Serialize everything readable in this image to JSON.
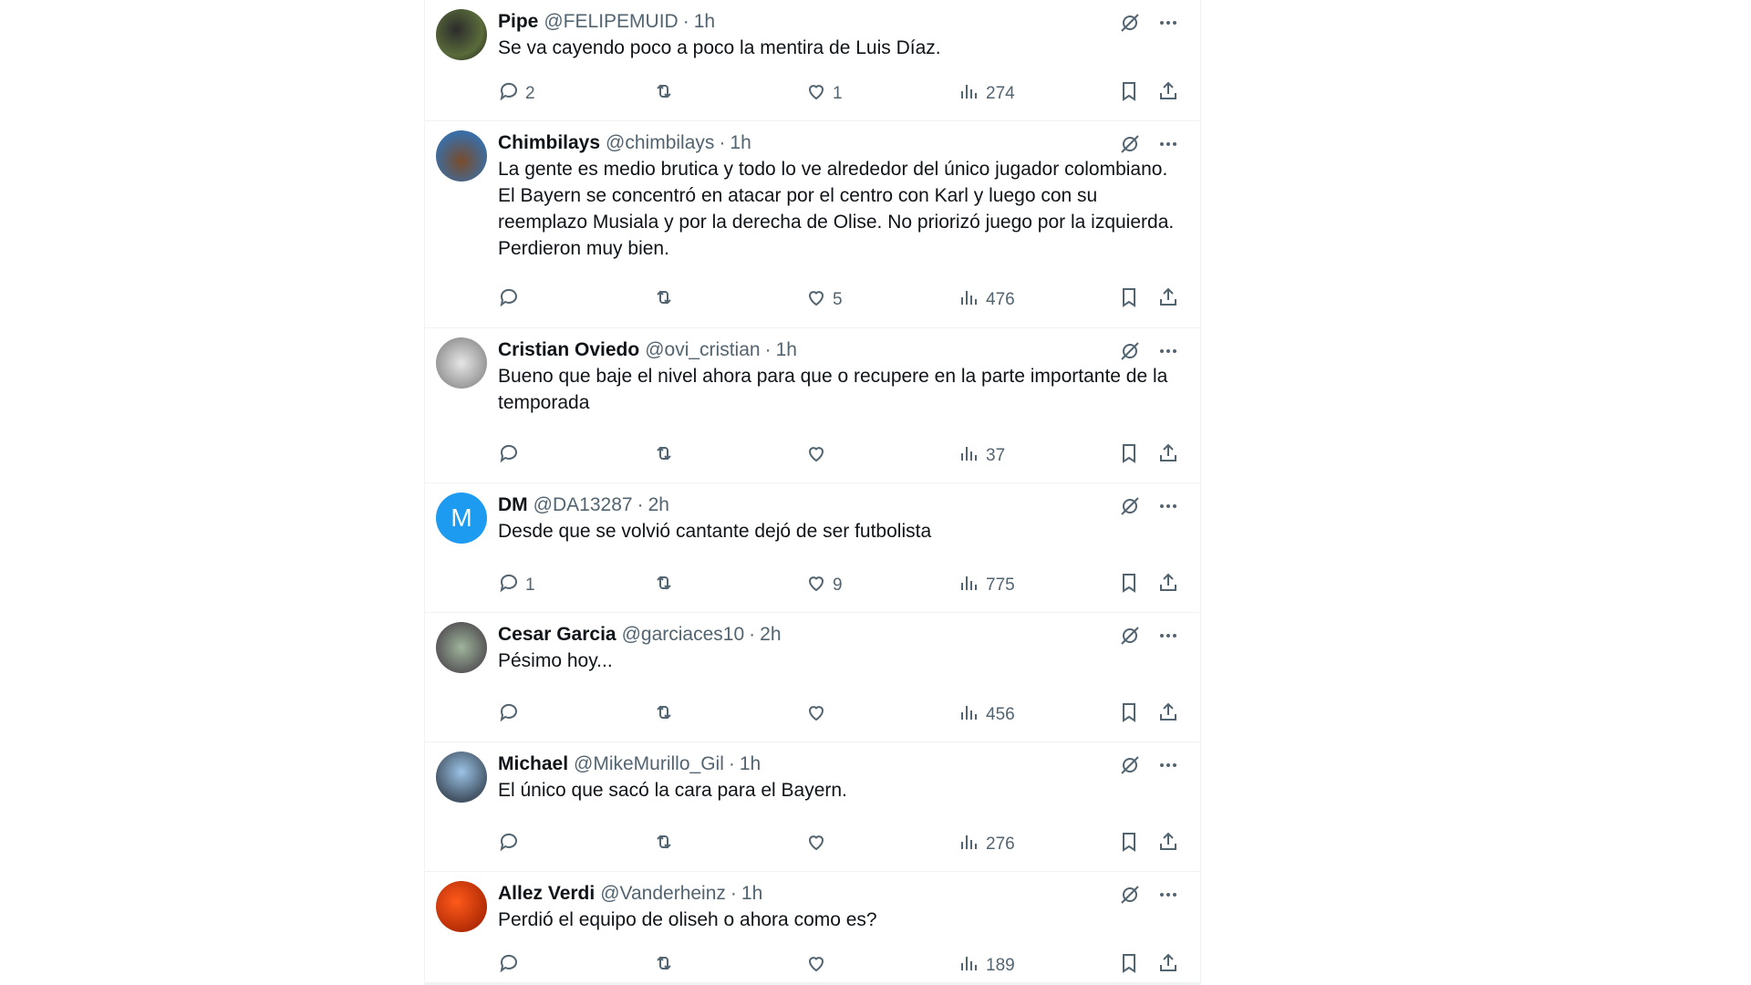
{
  "tweets": [
    {
      "name": "Pipe",
      "handle": "@FELIPEMUID",
      "time": "1h",
      "text": "Se va cayendo poco a poco la mentira de Luis Díaz.",
      "replies": "2",
      "reposts": "",
      "likes": "1",
      "views": "274",
      "avatar_letter": ""
    },
    {
      "name": "Chimbilays",
      "handle": "@chimbilays",
      "time": "1h",
      "text": "La gente es medio brutica y todo lo ve alrededor del único jugador colombiano. El Bayern se concentró en atacar por el centro con Karl y luego con su reemplazo Musiala y por la derecha de Olise. No priorizó juego por la izquierda. Perdieron muy bien.",
      "replies": "",
      "reposts": "",
      "likes": "5",
      "views": "476",
      "avatar_letter": ""
    },
    {
      "name": "Cristian Oviedo",
      "handle": "@ovi_cristian",
      "time": "1h",
      "text": "Bueno que baje el nivel ahora para que o recupere en la parte importante de la temporada",
      "replies": "",
      "reposts": "",
      "likes": "",
      "views": "37",
      "avatar_letter": ""
    },
    {
      "name": "DM",
      "handle": "@DA13287",
      "time": "2h",
      "text": "Desde que se volvió cantante dejó de ser futbolista",
      "replies": "1",
      "reposts": "",
      "likes": "9",
      "views": "775",
      "avatar_letter": "M"
    },
    {
      "name": "Cesar Garcia",
      "handle": "@garciaces10",
      "time": "2h",
      "text": "Pésimo hoy...",
      "replies": "",
      "reposts": "",
      "likes": "",
      "views": "456",
      "avatar_letter": ""
    },
    {
      "name": "Michael",
      "handle": "@MikeMurillo_Gil",
      "time": "1h",
      "text": "El único que sacó la cara para el Bayern.",
      "replies": "",
      "reposts": "",
      "likes": "",
      "views": "276",
      "avatar_letter": ""
    },
    {
      "name": "Allez Verdi",
      "handle": "@Vanderheinz",
      "time": "1h",
      "text": "Perdió el equipo de oliseh o ahora como es?",
      "replies": "",
      "reposts": "",
      "likes": "",
      "views": "189",
      "avatar_letter": ""
    }
  ],
  "separator": "·",
  "colors": {
    "text": "#0f1419",
    "muted": "#536471",
    "border": "#eff3f4",
    "avatar_dm": "#1d9bf0"
  },
  "icons": [
    "grok-icon",
    "more-icon",
    "reply-icon",
    "repost-icon",
    "like-icon",
    "views-icon",
    "bookmark-icon",
    "share-icon"
  ]
}
